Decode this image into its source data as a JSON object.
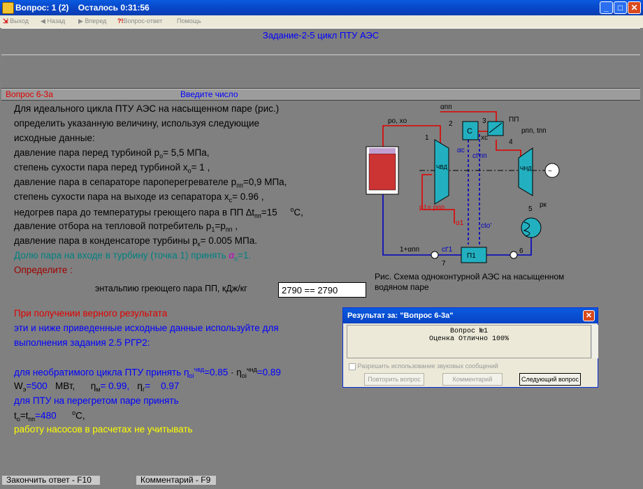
{
  "window": {
    "title": "Вопрос: 1 (2)    Осталось 0:31:56",
    "min": "_",
    "max": "□",
    "close": "✕"
  },
  "menu": {
    "exit": "Выход",
    "back": "Назад",
    "forward": "Вперед",
    "qa": "Вопрос-ответ",
    "help": "Помощь"
  },
  "header": {
    "title": "Задание-2-5  цикл ПТУ АЭС"
  },
  "question_bar": {
    "label": "Вопрос 6-3а",
    "hint": "Введите число"
  },
  "problem": {
    "l1": "Для идеального цикла ПТУ АЭС на насыщенном паре (рис.)",
    "l2": "определить указанную величину, используя следующие",
    "l3": "исходные данные:",
    "l4a": "давление пара перед турбиной p",
    "l4s": "o",
    "l4b": "= 5,5  МПа,",
    "l5a": "степень сухости пара перед турбиной x",
    "l5s": "o",
    "l5b": "= 1     ,",
    "l6a": "давление пара в сепараторе пароперегревателе p",
    "l6s": "пп",
    "l6b": "=0,9  МПа,",
    "l7a": "степень сухости пара на выходе из сепаратора x",
    "l7s": "c",
    "l7b": "= 0.96 ,",
    "l8a": "недогрев пара до температуры греющего пара в ПП ∆t",
    "l8s": "пп",
    "l8b": "=15     ",
    "l8sup": "o",
    "l8c": "C,",
    "l9a": "давление отбора на тепловой потребитель p",
    "l9s": "1",
    "l9b": "=p",
    "l9s2": "пп",
    "l9c": " ,",
    "l10a": "давление пара в конденсаторе турбины p",
    "l10s": "к",
    "l10b": "= 0.005 МПа.",
    "l11a": "Долю пара на входе в турбину (точка 1) принять ",
    "l11g": "α",
    "l11s": "o",
    "l11b": "=1.",
    "determine": "Определите :",
    "answer_label": "энтальпию греющего пара ПП, кДж/кг",
    "answer_value": "2790 == 2790"
  },
  "instructions": {
    "r1": "При получении верного результата",
    "r2": "эти и ниже приведенные исходные данные используйте для",
    "r3": "выполнения задания 2.5 РГР2:",
    "e1a": "для необратимого цикла ПТУ принять  η",
    "e1s1": "oi",
    "e1sup1": "чвд",
    "e1v1": "=0.85",
    "e1sep": " · ",
    "e1b": "η",
    "e1s2": "oi",
    "e1sup2": "чнд",
    "e1v2": "=0.89",
    "e2a": "W",
    "e2s": "э",
    "e2v": "=500",
    "e2u": "   МВт,",
    "e2m": "η",
    "e2ms": "м",
    "e2mv": "= 0.99,",
    "e2g": "η",
    "e2gs": "г",
    "e2gv": "=    0.97",
    "e3": "для ПТУ на перегретом паре принять",
    "e4a": "t",
    "e4s": "o",
    "e4b": "=t",
    "e4s2": "пп",
    "e4v": "=480",
    "e4sup": "o",
    "e4u": "C,",
    "e5": "работу насосов в расчетах не учитывать"
  },
  "diagram": {
    "caption1": "Рис.  Схема одноконтурной АЭС на насыщенном",
    "caption2": "водяном паре",
    "labels": {
      "alpha_pp": "αпп",
      "po_xo": "pо, xо",
      "pt1": "1",
      "pt2": "2",
      "pt3": "3",
      "pt4": "4",
      "pt5": "5",
      "pt6": "6",
      "pt7": "7",
      "sep": "C",
      "pp": "ПП",
      "ppp_tpp": "pпп, tпп",
      "xc": "xс",
      "alpha_c": "αс",
      "ct_pp": "ct'пп",
      "hpt": "ЧВД",
      "lpt": "ЧНД",
      "p1": "p1= pпп",
      "alpha1": "α1",
      "ct_o": "cto'",
      "pk": "pк",
      "one_plus": "1+αпп",
      "ct1": "ct'1",
      "heater": "П1"
    }
  },
  "result_dialog": {
    "title": "Результат за: \"Вопрос 6-3а\"",
    "line1": "Вопрос №1",
    "line2": "Оценка Отлично 100%",
    "checkbox": "Разрешить использование звуковых сообщений",
    "btn_repeat": "Повторить вопрос",
    "btn_comment": "Комментарий",
    "btn_next": "Следующий вопрос"
  },
  "status": {
    "finish": "Закончить ответ - F10",
    "comment": "Комментарий - F9"
  }
}
